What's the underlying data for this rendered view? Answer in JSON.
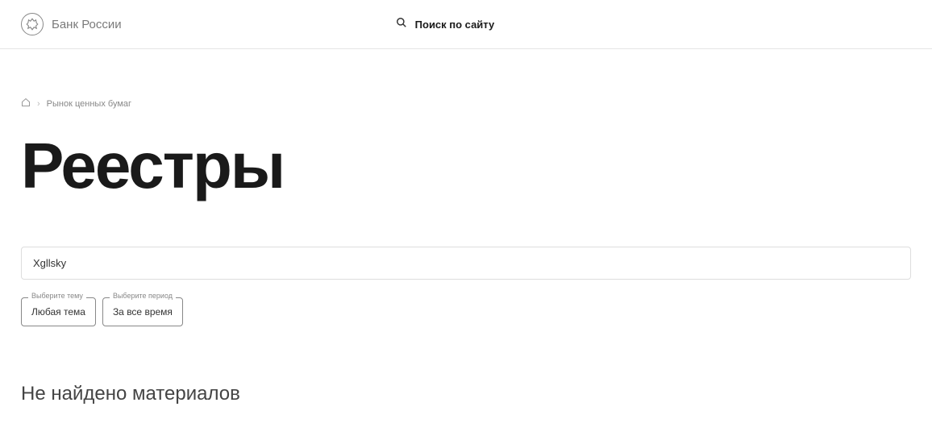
{
  "header": {
    "logo_text": "Банк России",
    "search_label": "Поиск по сайту"
  },
  "breadcrumb": {
    "items": [
      "Рынок ценных бумаг"
    ]
  },
  "page": {
    "title": "Реестры"
  },
  "filters": {
    "search_value": "Xgllsky",
    "topic": {
      "legend": "Выберите тему",
      "value": "Любая тема"
    },
    "period": {
      "legend": "Выберите период",
      "value": "За все время"
    }
  },
  "results": {
    "no_results_message": "Не найдено материалов"
  }
}
